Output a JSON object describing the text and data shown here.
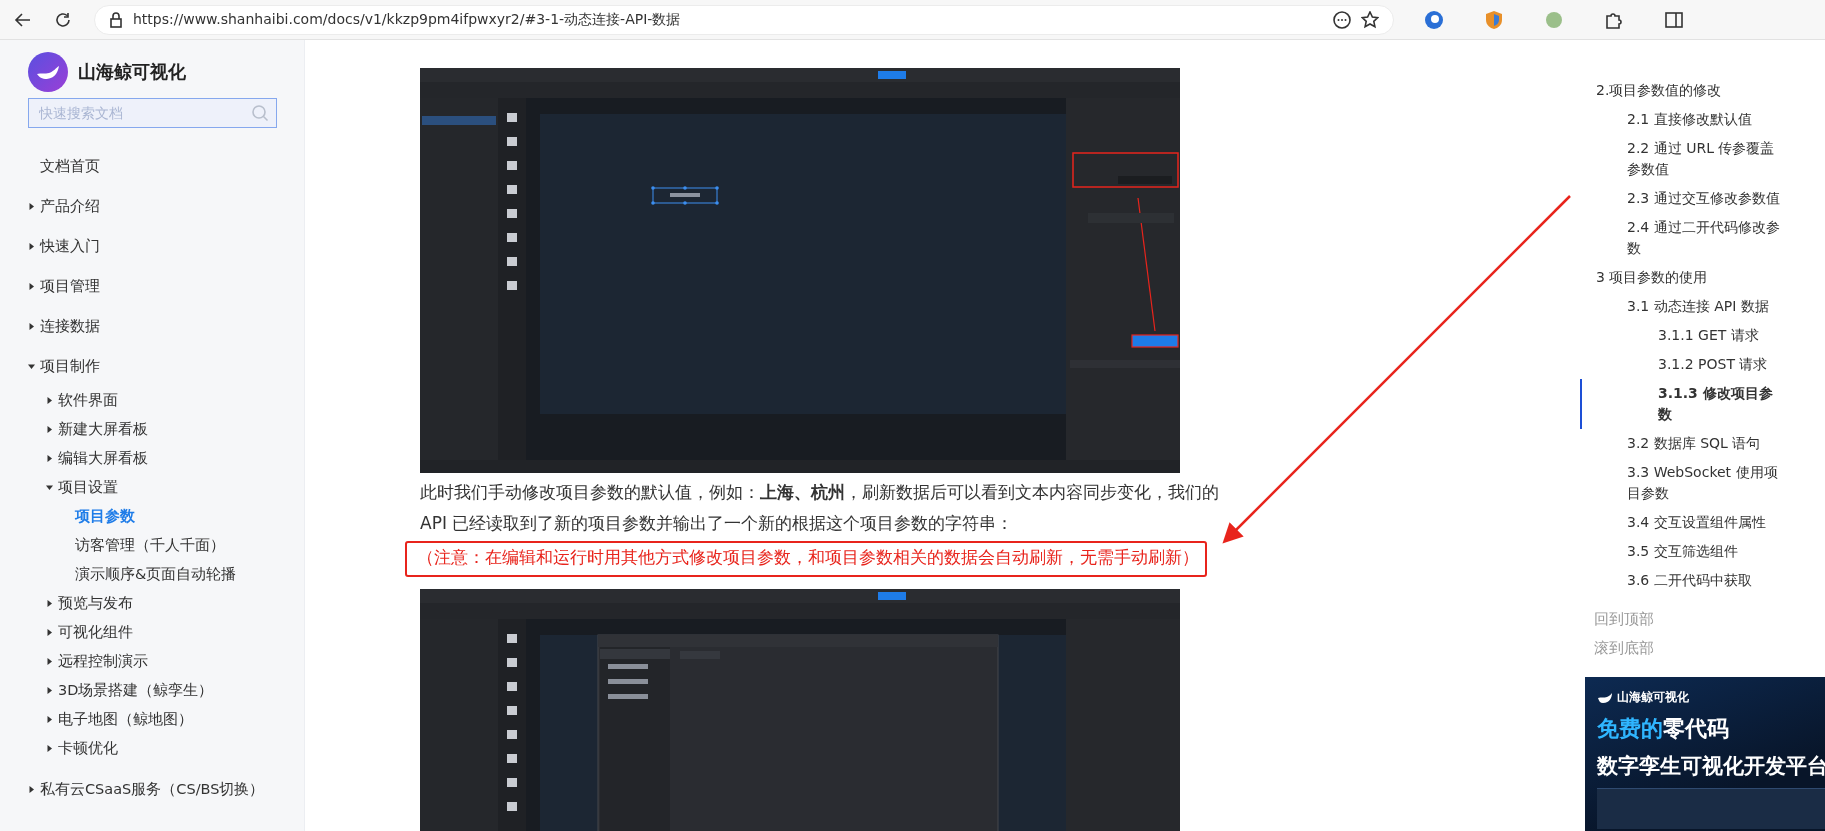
{
  "browser": {
    "url": "https://www.shanhaibi.com/docs/v1/kkzp9pm4ifpwxyr2/#3-1-动态连接-API-数据"
  },
  "sidebar": {
    "brand": "山海鲸可视化",
    "search": {
      "placeholder": "快速搜索文档"
    },
    "nav": [
      {
        "label": "文档首页",
        "selected": false
      },
      {
        "label": "产品介绍",
        "expanded": false,
        "selected": false
      },
      {
        "label": "快速入门",
        "expanded": false,
        "selected": false
      },
      {
        "label": "项目管理",
        "expanded": false,
        "selected": false
      },
      {
        "label": "连接数据",
        "expanded": false,
        "selected": false
      },
      {
        "label": "项目制作",
        "expanded": true,
        "selected": false,
        "children": [
          {
            "label": "软件界面",
            "expanded": false,
            "selected": false
          },
          {
            "label": "新建大屏看板",
            "expanded": false,
            "selected": false
          },
          {
            "label": "编辑大屏看板",
            "expanded": false,
            "selected": false
          },
          {
            "label": "项目设置",
            "expanded": true,
            "selected": false,
            "children": [
              {
                "label": "项目参数",
                "selected": true
              },
              {
                "label": "访客管理（千人千面）",
                "selected": false
              },
              {
                "label": "演示顺序&页面自动轮播",
                "selected": false
              }
            ]
          },
          {
            "label": "预览与发布",
            "expanded": false,
            "selected": false
          },
          {
            "label": "可视化组件",
            "expanded": false,
            "selected": false
          },
          {
            "label": "远程控制演示",
            "expanded": false,
            "selected": false
          },
          {
            "label": "3D场景搭建（鲸孪生）",
            "expanded": false,
            "selected": false
          },
          {
            "label": "电子地图（鲸地图）",
            "expanded": false,
            "selected": false
          },
          {
            "label": "卡顿优化",
            "expanded": false,
            "selected": false
          }
        ]
      },
      {
        "label": "私有云CSaaS服务（CS/BS切换）",
        "expanded": false,
        "selected": false
      }
    ]
  },
  "content": {
    "screenshots": [
      {
        "kind": "editor"
      },
      {
        "kind": "settings-dialog"
      }
    ],
    "paragraph": "此时我们手动修改项目参数的默认值，例如：**上海、杭州**，刷新数据后可以看到文本内容同步变化，我们的 API 已经读取到了新的项目参数并输出了一个新的根据这个项目参数的字符串：",
    "note": "（注意：在编辑和运行时用其他方式修改项目参数，和项目参数相关的数据会自动刷新，无需手动刷新）"
  },
  "toc": {
    "items": [
      {
        "label": "2.项目参数值的修改",
        "selected": false,
        "children": [
          {
            "label": "2.1 直接修改默认值",
            "selected": false
          },
          {
            "label": "2.2 通过 URL 传参覆盖参数值",
            "selected": false
          },
          {
            "label": "2.3 通过交互修改参数值",
            "selected": false
          },
          {
            "label": "2.4 通过二开代码修改参数",
            "selected": false
          }
        ]
      },
      {
        "label": "3 项目参数的使用",
        "selected": false,
        "children": [
          {
            "label": "3.1 动态连接 API 数据",
            "selected": false,
            "children": [
              {
                "label": "3.1.1 GET 请求",
                "selected": false
              },
              {
                "label": "3.1.2 POST 请求",
                "selected": false
              },
              {
                "label": "3.1.3 修改项目参数",
                "selected": true
              }
            ]
          },
          {
            "label": "3.2 数据库 SQL 语句",
            "selected": false
          },
          {
            "label": "3.3 WebSocket 使用项目参数",
            "selected": false
          },
          {
            "label": "3.4 交互设置组件属性",
            "selected": false
          },
          {
            "label": "3.5 交互筛选组件",
            "selected": false
          },
          {
            "label": "3.6 二开代码中获取",
            "selected": false
          }
        ]
      }
    ],
    "links": [
      "回到顶部",
      "滚到底部"
    ],
    "banner": {
      "brand": "山海鲸可视化",
      "highlight": "免费的",
      "headline": "零代码",
      "subline": "数字孪生可视化开发平台"
    }
  }
}
